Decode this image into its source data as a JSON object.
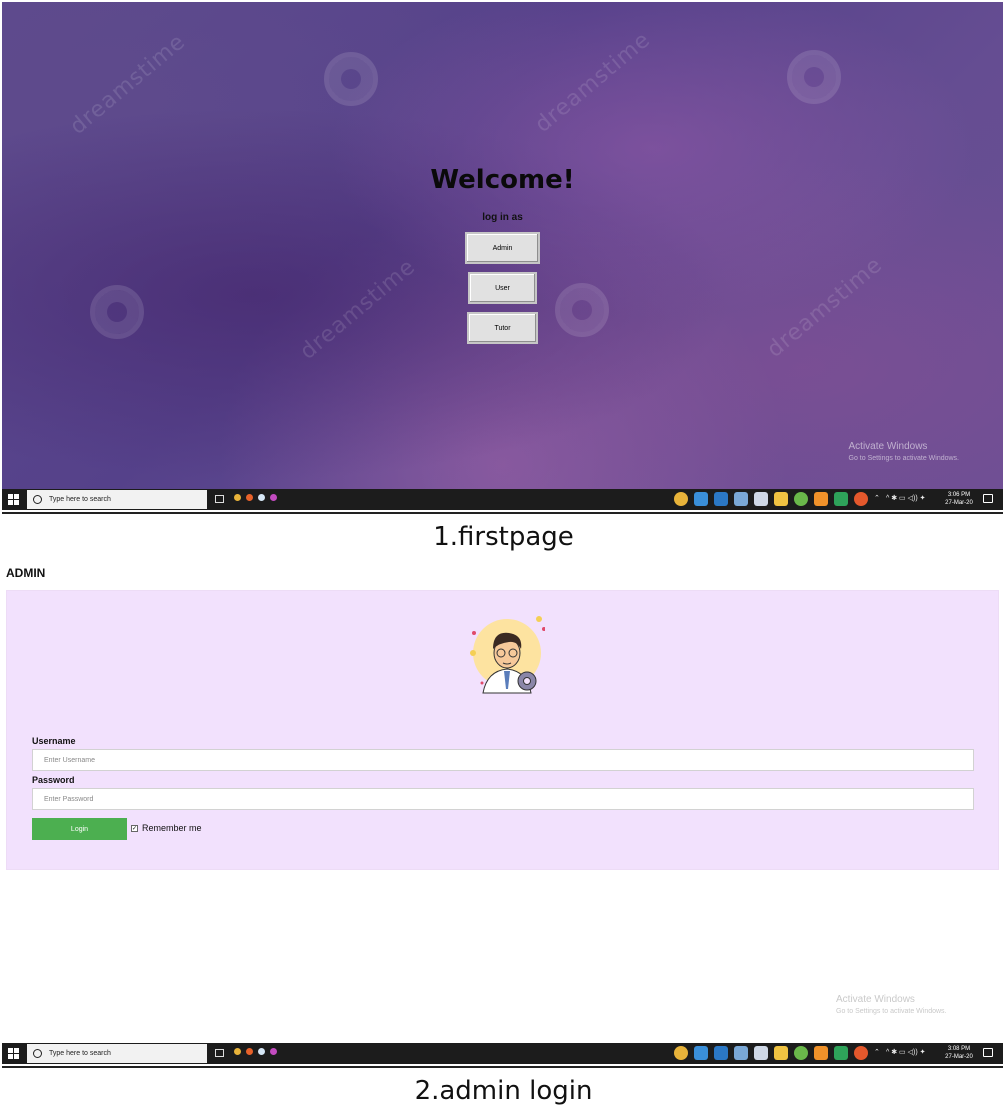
{
  "screens": [
    {
      "welcome_title": "Welcome!",
      "prompt": "log in as",
      "roles": [
        "Admin",
        "User",
        "Tutor"
      ],
      "watermark": "dreamstime",
      "activate": {
        "title": "Activate Windows",
        "subtitle": "Go to Settings to activate Windows."
      },
      "taskbar": {
        "search_placeholder": "Type here to search",
        "time": "3:06 PM",
        "date": "27-Mar-20"
      },
      "caption": "1.firstpage"
    },
    {
      "heading": "ADMIN",
      "form": {
        "username_label": "Username",
        "username_placeholder": "Enter Username",
        "password_label": "Password",
        "password_placeholder": "Enter Password",
        "login_label": "Login",
        "remember_label": "Remember me",
        "remember_checked": true
      },
      "activate": {
        "title": "Activate Windows",
        "subtitle": "Go to Settings to activate Windows."
      },
      "taskbar": {
        "search_placeholder": "Type here to search",
        "time": "3:08 PM",
        "date": "27-Mar-20"
      },
      "caption": "2.admin login"
    }
  ],
  "colors": {
    "login_button": "#4caf50",
    "panel_bg": "#f2e1fd",
    "taskbar": "#1c1c1c"
  }
}
